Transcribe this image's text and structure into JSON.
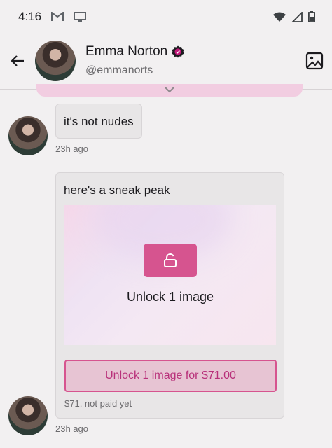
{
  "status_bar": {
    "time": "4:16"
  },
  "header": {
    "name": "Emma Norton",
    "handle": "@emmanorts"
  },
  "messages": [
    {
      "text": "it's not nudes",
      "time": "23h ago"
    },
    {
      "text": "here's a sneak peak",
      "media_caption": "Unlock 1 image",
      "unlock_label": "Unlock 1 image for $71.00",
      "status": "$71, not paid yet",
      "time": "23h ago"
    }
  ],
  "colors": {
    "accent": "#d6548f",
    "verified": "#7b1fa2"
  },
  "icons": [
    "back-arrow-icon",
    "verified-badge-icon",
    "gallery-icon",
    "unlock-icon",
    "gmail-icon",
    "screen-cast-icon",
    "wifi-icon",
    "signal-icon",
    "battery-icon"
  ]
}
